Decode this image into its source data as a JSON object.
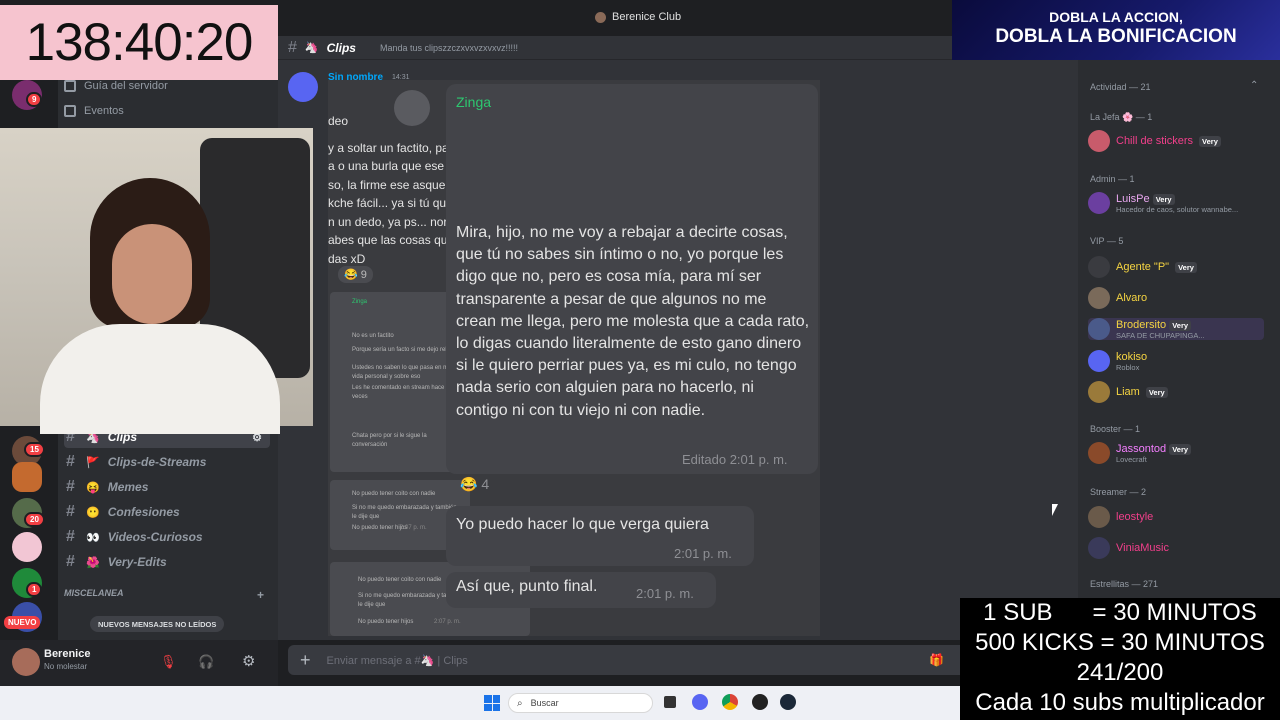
{
  "window": {
    "title": "Berenice Club"
  },
  "stream": {
    "timer": "138:40:20",
    "promo": {
      "line1": "DOBLA LA ACCION,",
      "line2": "DOBLA LA BONIFICACION"
    },
    "rules": [
      "1 SUB      = 30 MINUTOS",
      "500 KICKS = 30 MINUTOS",
      "241/200",
      "Cada 10 subs multiplicador"
    ]
  },
  "sidebar": {
    "guide": "Guía del servidor",
    "events": "Eventos",
    "new_badge": "NUEVO",
    "unread_banner": "NUEVOS MENSAJES NO LEÍDOS",
    "category": "MISCELANEA",
    "channels": [
      {
        "emoji": "🦄",
        "name": "Clips",
        "active": true
      },
      {
        "emoji": "🚩",
        "name": "Clips-de-Streams",
        "active": false
      },
      {
        "emoji": "😝",
        "name": "Memes",
        "active": false
      },
      {
        "emoji": "😶",
        "name": "Confesiones",
        "active": false
      },
      {
        "emoji": "👀",
        "name": "Videos-Curiosos",
        "active": false
      },
      {
        "emoji": "🌺",
        "name": "Very-Edits",
        "active": false
      }
    ],
    "guild_badges": [
      "9",
      "15",
      "20",
      "1"
    ]
  },
  "user": {
    "name": "Berenice",
    "status": "No molestar"
  },
  "channel": {
    "emoji": "🦄",
    "name": "Clips",
    "topic": "Manda tus clipszzczxvxvzxvxvz!!!!!",
    "composer_placeholder": "Enviar mensaje a #🦄 | Clips"
  },
  "message": {
    "author": "Sin nombre",
    "time": "14:31",
    "left_partial_lines": [
      "deo",
      "y a soltar un factito, para ti es una",
      "a o una burla que ese sujeto sea",
      "so, la firme ese asqueroso solo te",
      "kche fácil... ya si tú quieres tapar",
      "n un dedo, ya ps... normal Zingar",
      "abes que las cosas que digo no",
      "das xD"
    ],
    "reaction_count": "9",
    "main_author": "Zinga",
    "main_text": "Mira, hijo, no me voy a rebajar a decirte cosas, que tú no sabes sin íntimo o no, yo porque les digo que no, pero es cosa mía, para mí ser transparente a pesar de que algunos no me crean me llega, pero me molesta que a cada rato, lo digas cuando literalmente de esto gano dinero si le quiero perriar pues ya, es mi culo, no tengo nada serio con alguien para no hacerlo, ni contigo ni con tu viejo ni con nadie.",
    "edited": "Editado 2:01 p. m.",
    "reaction2_count": "4",
    "reply1": "Yo puedo hacer lo que verga quiera",
    "reply1_time": "2:01 p. m.",
    "reply2": "Así que, punto final.",
    "reply2_time": "2:01 p. m.",
    "small_lines_a": [
      "No es un factito",
      "Porque sería un facto si me dejo rebajar",
      "Ustedes no saben lo que pasa en mi vida personal y sobre eso",
      "Les he comentado en stream hace mil veces",
      "Chata pero por si le sigue la conversación"
    ],
    "small_lines_b": [
      "No puedo tener coito con nadie",
      "Si no me quedo embarazada y también le dije que",
      "No puedo tener hijos"
    ],
    "small_times": [
      "2:07 p. m.",
      "2:07 p. m."
    ]
  },
  "members": {
    "activity_header": "Actividad — 21",
    "sections": [
      {
        "title": "La Jefa 🌸 — 1",
        "items": [
          {
            "name": "Chill de stickers",
            "tag": "Very",
            "sub": "",
            "color": "#f23f8b"
          }
        ]
      },
      {
        "title": "Admin — 1",
        "items": [
          {
            "name": "LuisPe",
            "tag": "Very",
            "sub": "Hacedor de caos, solutor wannabe...",
            "color": "#e9a7f0"
          }
        ]
      },
      {
        "title": "VIP — 5",
        "items": [
          {
            "name": "Agente \"P\"",
            "tag": "Very",
            "sub": "",
            "color": "#f5d442"
          },
          {
            "name": "Alvaro",
            "tag": "",
            "sub": "",
            "color": "#f5d442"
          },
          {
            "name": "Brodersito",
            "tag": "Very",
            "sub": "SAFA DE CHUPAPINGA...",
            "color": "#f5d442"
          },
          {
            "name": "kokiso",
            "tag": "",
            "sub": "Roblox",
            "color": "#f5d442"
          },
          {
            "name": "Liam",
            "tag": "Very",
            "sub": "",
            "color": "#f5d442"
          }
        ]
      },
      {
        "title": "Booster — 1",
        "items": [
          {
            "name": "Jassontod",
            "tag": "Very",
            "sub": "Lovecraft",
            "color": "#f47fff"
          }
        ]
      },
      {
        "title": "Streamer — 2",
        "items": [
          {
            "name": "leostyle",
            "tag": "",
            "sub": "",
            "color": "#f23f8b"
          },
          {
            "name": "ViniaMusic",
            "tag": "",
            "sub": "",
            "color": "#f23f8b"
          }
        ]
      },
      {
        "title": "Estrellitas — 271",
        "items": []
      }
    ]
  },
  "taskbar": {
    "search_placeholder": "Buscar"
  },
  "colors": {
    "accent": "#5865f2",
    "danger": "#f23f43",
    "timer_bg": "#f6c4cf"
  }
}
